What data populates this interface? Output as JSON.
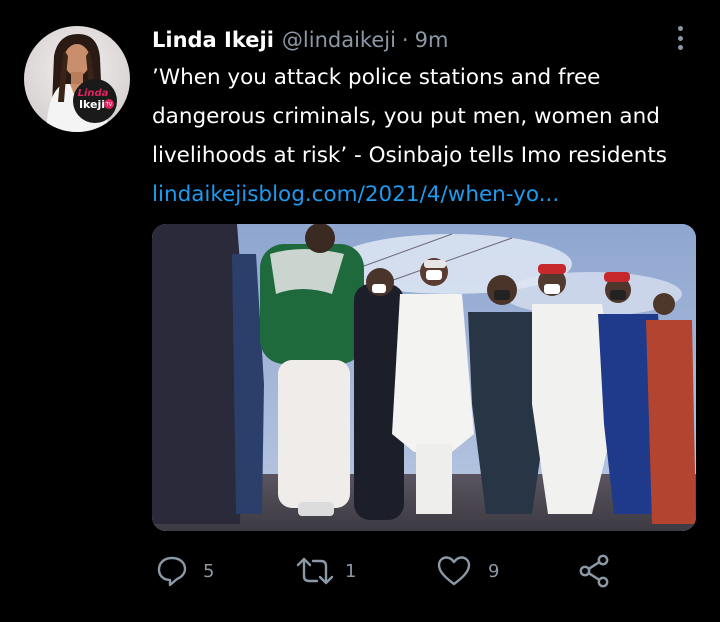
{
  "tweet": {
    "author": {
      "display_name": "Linda Ikeji",
      "handle": "@lindaikeji",
      "avatar_icon": "profile-photo",
      "avatar_logo_text": [
        "Linda",
        "Ikeji",
        "TV"
      ]
    },
    "separator": "·",
    "timestamp": "9m",
    "text_lines": [
      "’When you attack police stations and free",
      "dangerous criminals, you put men, women and",
      "livelihoods at risk’ - Osinbajo tells Imo residents"
    ],
    "link": "lindaikejisblog.com/2021/4/when-yo...",
    "media": {
      "description_icon": "group-photo"
    },
    "actions": {
      "reply": {
        "icon": "reply-icon",
        "count": "5"
      },
      "retweet": {
        "icon": "retweet-icon",
        "count": "1"
      },
      "like": {
        "icon": "like-icon",
        "count": "9"
      },
      "share": {
        "icon": "share-icon"
      }
    },
    "more_icon": "more-vertical-icon"
  },
  "colors": {
    "background": "#000000",
    "text": "#ffffff",
    "secondary": "#8b98a5",
    "link": "#1d9bf0"
  }
}
